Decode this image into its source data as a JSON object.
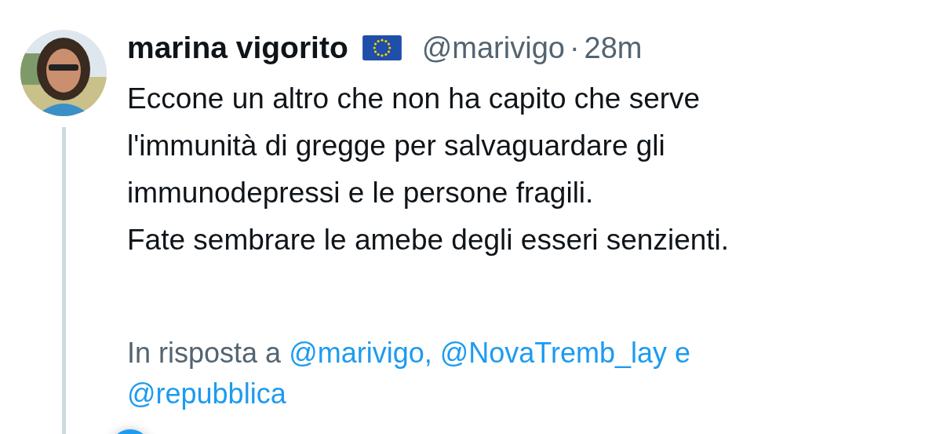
{
  "tweet": {
    "author": {
      "name": "marina vigorito",
      "handle": "@marivigo",
      "time": "28m",
      "separator": "·"
    },
    "text_lines": [
      "Eccone un altro che non ha capito che serve",
      "l'immunità di gregge per salvaguardare gli",
      "immunodepressi e le persone fragili.",
      "Fate sembrare le amebe degli esseri senzienti."
    ],
    "reply_to": {
      "prefix": "In risposta a",
      "mentions": [
        "@marivigo,",
        "@NovaTremb_lay e",
        "@repubblica"
      ]
    }
  }
}
